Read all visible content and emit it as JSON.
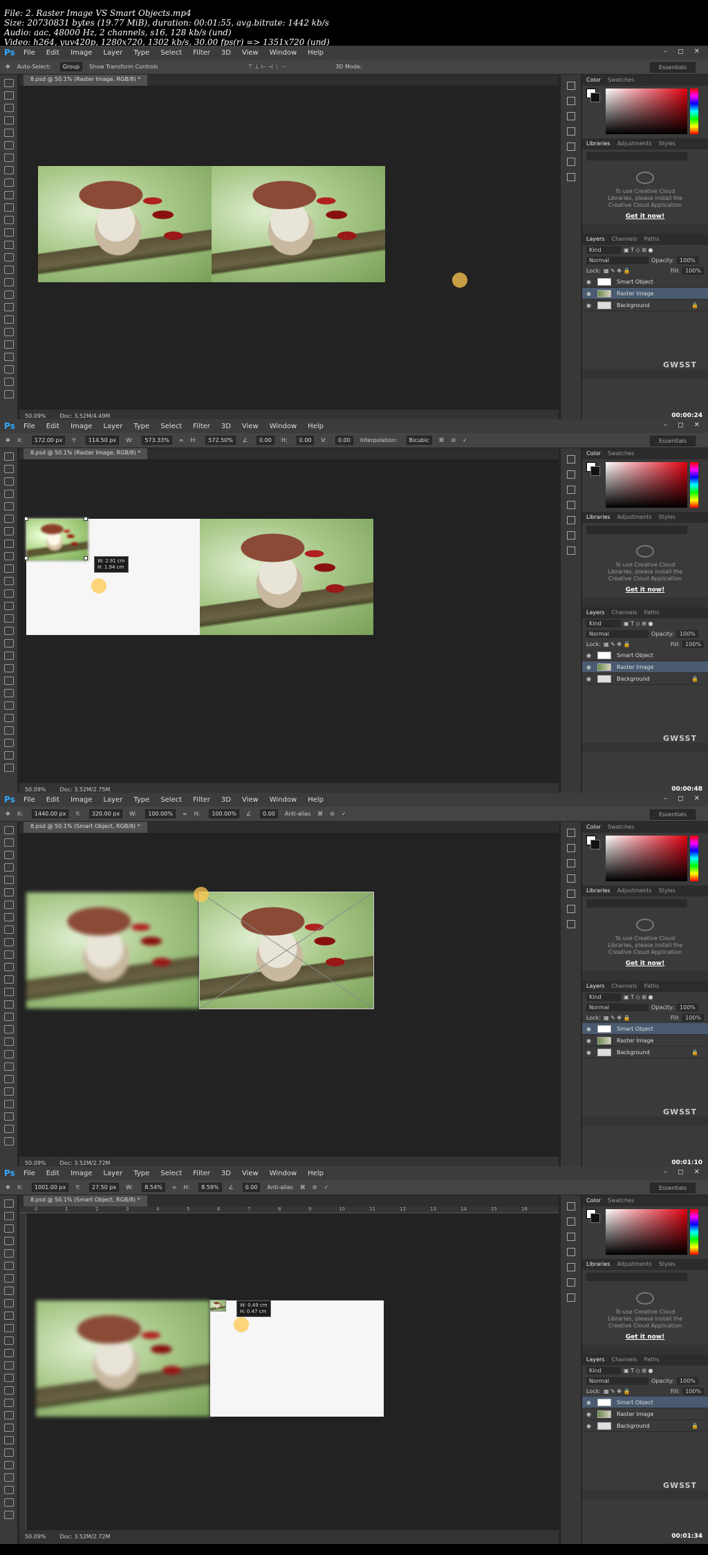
{
  "media_info": {
    "line1": "File: 2. Raster Image VS Smart Objects.mp4",
    "line2": "Size: 20730831 bytes (19.77 MiB), duration: 00:01:55, avg.bitrate: 1442 kb/s",
    "line3": "Audio: aac, 48000 Hz, 2 channels, s16, 128 kb/s (und)",
    "line4": "Video: h264, yuv420p, 1280x720, 1302 kb/s, 30.00 fps(r) => 1351x720 (und)"
  },
  "app": {
    "logo": "Ps",
    "menus": [
      "File",
      "Edit",
      "Image",
      "Layer",
      "Type",
      "Select",
      "Filter",
      "3D",
      "View",
      "Window",
      "Help"
    ],
    "window_buttons": "– ◻ ✕",
    "workspace": "Essentials"
  },
  "frames": [
    {
      "tab": "8.psd @ 50.1% (Raster Image, RGB/8) *",
      "zoom": "50.09%",
      "doc": "Doc: 3.52M/4.49M",
      "timestamp": "00:00:24",
      "options": {
        "auto_select": "Auto-Select:",
        "group": "Group",
        "show_transform": "Show Transform Controls",
        "mode3d": "3D Mode:"
      },
      "layers": [
        {
          "name": "Smart Object",
          "sel": false,
          "lock": false,
          "thumb": "smart"
        },
        {
          "name": "Raster Image",
          "sel": true,
          "lock": false,
          "thumb": "raster"
        },
        {
          "name": "Background",
          "sel": false,
          "lock": true,
          "thumb": "white"
        }
      ]
    },
    {
      "tab": "8.psd @ 50.1% (Raster Image, RGB/8) *",
      "zoom": "50.09%",
      "doc": "Doc: 3.52M/2.75M",
      "timestamp": "00:00:48",
      "options": {
        "x": "172.00 px",
        "y": "114.50 px",
        "w": "573.33%",
        "h": "572.50%",
        "angle": "0.00",
        "hs": "0.00",
        "vs": "0.00",
        "interp_label": "Interpolation:",
        "interp": "Bicubic"
      },
      "tooltip": {
        "w": "W: 2.91 cm",
        "h": "H: 1.94 cm"
      },
      "layers": [
        {
          "name": "Smart Object",
          "sel": false,
          "lock": false,
          "thumb": "smart"
        },
        {
          "name": "Raster Image",
          "sel": true,
          "lock": false,
          "thumb": "raster"
        },
        {
          "name": "Background",
          "sel": false,
          "lock": true,
          "thumb": "white"
        }
      ]
    },
    {
      "tab": "8.psd @ 50.1% (Smart Object, RGB/8) *",
      "zoom": "50.09%",
      "doc": "Doc: 3.52M/2.72M",
      "timestamp": "00:01:10",
      "options": {
        "x": "1440.00 px",
        "y": "320.00 px",
        "w": "100.00%",
        "h": "100.00%",
        "angle": "0.00",
        "antialias": "Anti-alias"
      },
      "layers": [
        {
          "name": "Smart Object",
          "sel": true,
          "lock": false,
          "thumb": "smart"
        },
        {
          "name": "Raster Image",
          "sel": false,
          "lock": false,
          "thumb": "raster"
        },
        {
          "name": "Background",
          "sel": false,
          "lock": true,
          "thumb": "white"
        }
      ]
    },
    {
      "tab": "8.psd @ 50.1% (Smart Object, RGB/8) *",
      "zoom": "50.09%",
      "doc": "Doc: 3.52M/2.72M",
      "timestamp": "00:01:34",
      "options": {
        "x": "1001.00 px",
        "y": "27.50 px",
        "w": "8.54%",
        "h": "8.59%",
        "angle": "0.00",
        "antialias": "Anti-alias"
      },
      "tooltip": {
        "w": "W: 0.49 cm",
        "h": "H: 0.47 cm"
      },
      "ruler_ticks": [
        "0",
        "1",
        "2",
        "3",
        "4",
        "5",
        "6",
        "7",
        "8",
        "9",
        "10",
        "11",
        "12",
        "13",
        "14",
        "15",
        "16"
      ],
      "layers": [
        {
          "name": "Smart Object",
          "sel": true,
          "lock": false,
          "thumb": "smart"
        },
        {
          "name": "Raster Image",
          "sel": false,
          "lock": false,
          "thumb": "raster"
        },
        {
          "name": "Background",
          "sel": false,
          "lock": true,
          "thumb": "white"
        }
      ]
    }
  ],
  "panels": {
    "color_tabs": [
      "Color",
      "Swatches"
    ],
    "lib_tabs": [
      "Libraries",
      "Adjustments",
      "Styles"
    ],
    "lib_message": "To use Creative Cloud Libraries, please install the Creative Cloud Application",
    "lib_link": "Get it now!",
    "layer_tabs": [
      "Layers",
      "Channels",
      "Paths"
    ],
    "kind": "Kind",
    "blend": "Normal",
    "opacity_label": "Opacity:",
    "opacity": "100%",
    "lock_label": "Lock:",
    "fill_label": "Fill:",
    "fill": "100%",
    "watermark": "GWSST"
  },
  "colors": {
    "ps_blue": "#31a8ff",
    "panel": "#3a3a3a",
    "canvas": "#222222",
    "selected_layer": "#4a5a70"
  }
}
